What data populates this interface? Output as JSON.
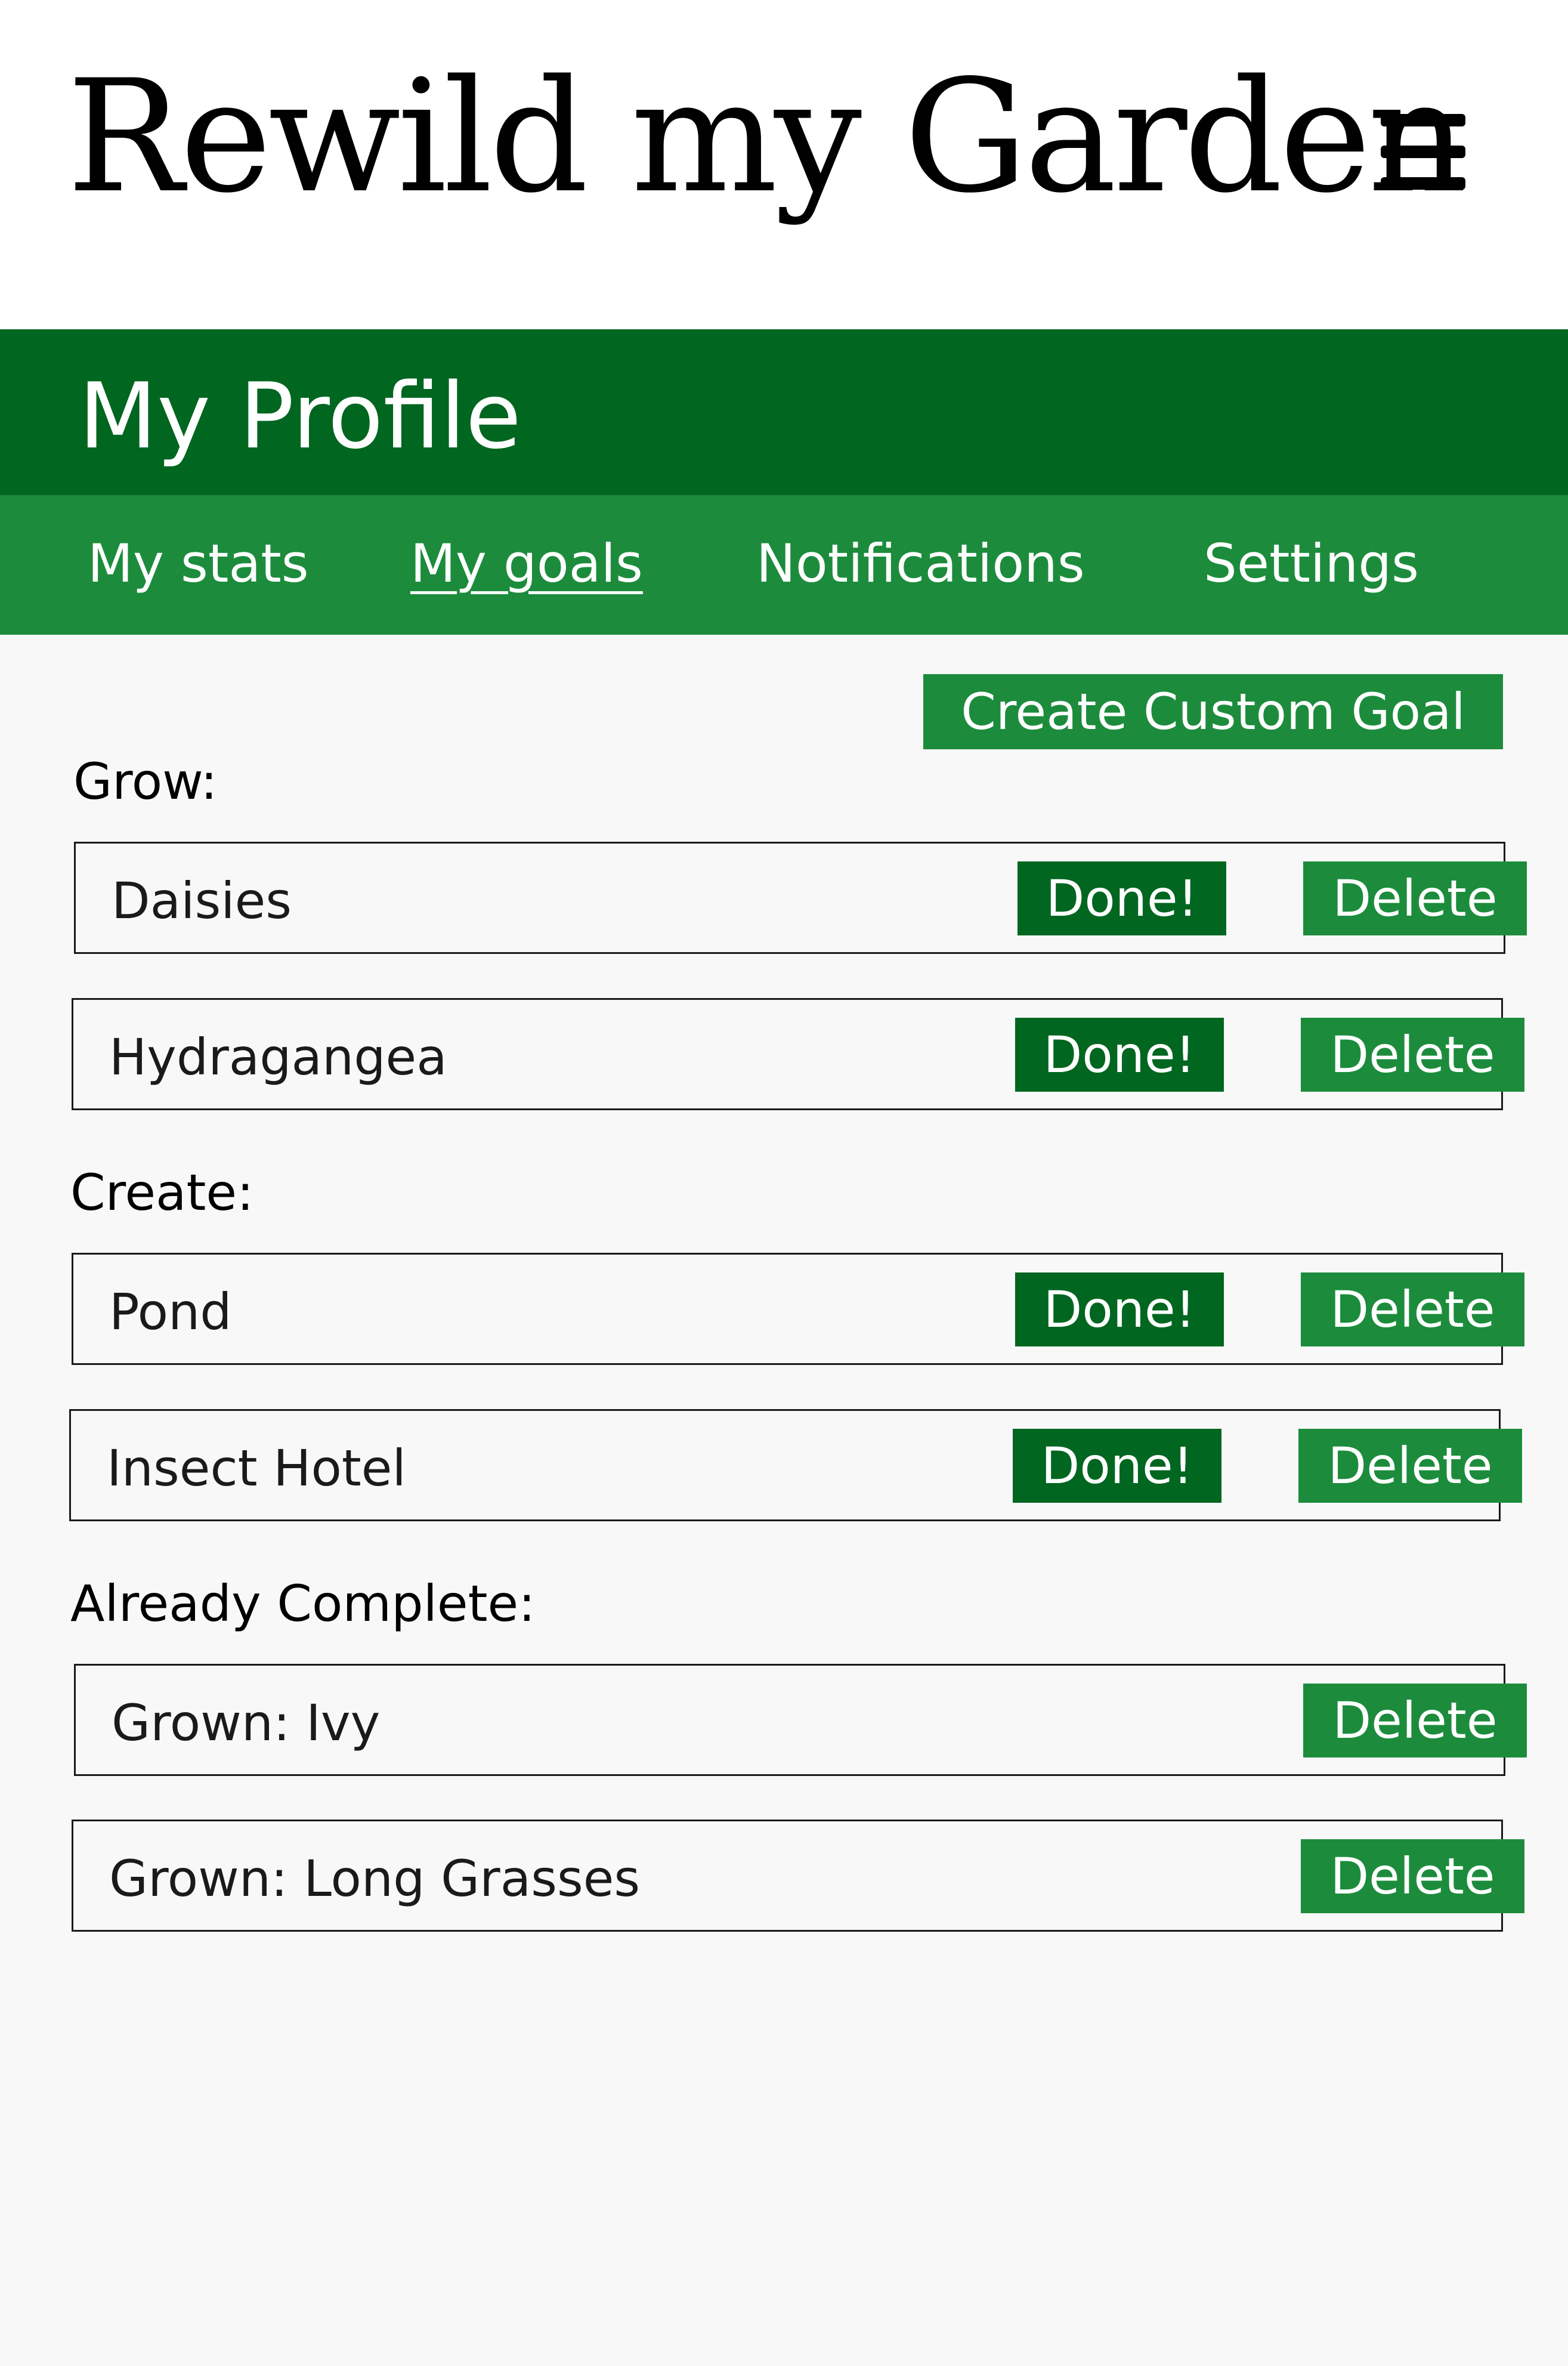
{
  "app": {
    "logo_text": "Rewild my Garden",
    "menu_icon": "hamburger-menu-icon"
  },
  "colors": {
    "banner_bg": "#006620",
    "tabs_bg": "#1c8c3c",
    "primary_button": "#1c8c3c",
    "done_button": "#006620",
    "page_bg": "#f8f8f8",
    "header_bg": "#ffffff"
  },
  "profile": {
    "title": "My Profile",
    "tabs": [
      {
        "label": "My stats",
        "active": false
      },
      {
        "label": "My goals",
        "active": true
      },
      {
        "label": "Notifications",
        "active": false
      },
      {
        "label": "Settings",
        "active": false
      }
    ]
  },
  "goals": {
    "create_button": "Create Custom Goal",
    "done_label": "Done!",
    "delete_label": "Delete",
    "sections": [
      {
        "heading": "Grow:",
        "items": [
          "Daisies",
          "Hydragangea"
        ]
      },
      {
        "heading": "Create:",
        "items": [
          "Pond",
          "Insect Hotel"
        ]
      },
      {
        "heading": "Already Complete:",
        "items": [
          "Grown: Ivy",
          "Grown: Long Grasses"
        ]
      }
    ]
  }
}
